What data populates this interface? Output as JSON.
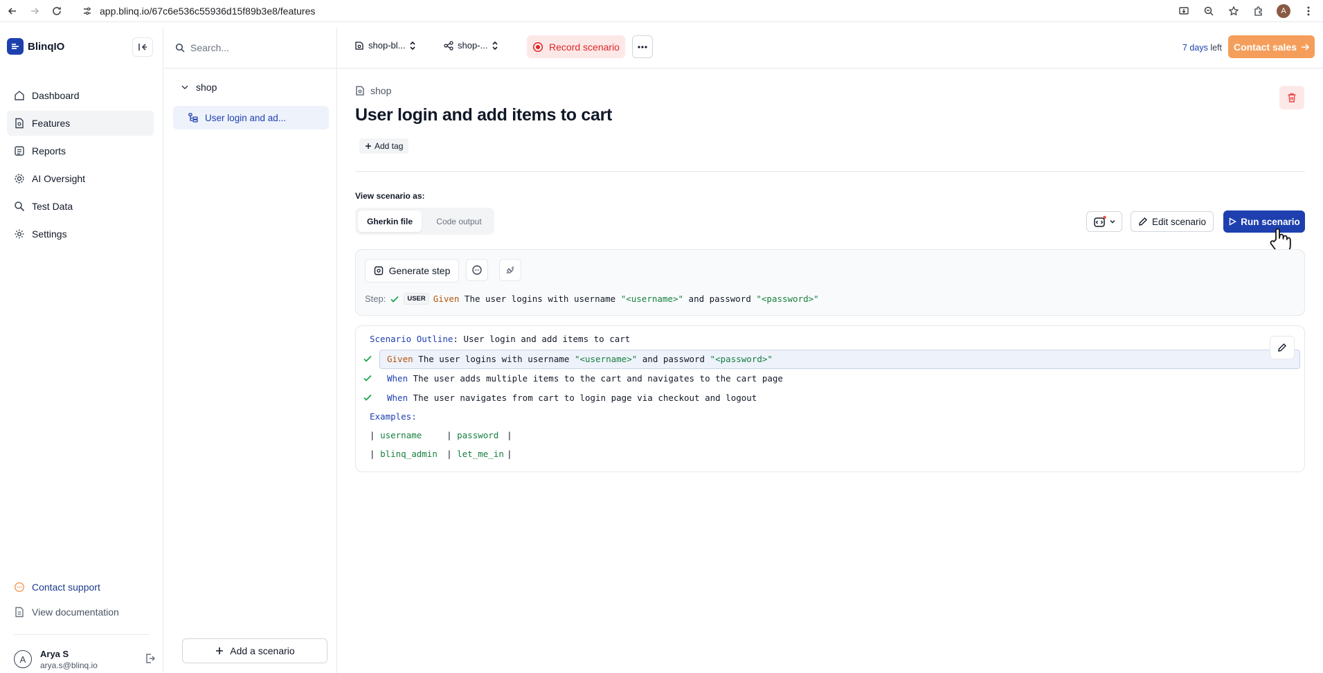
{
  "browser": {
    "url": "app.blinq.io/67c6e536c55936d15f89b3e8/features",
    "profile_initial": "A"
  },
  "sidebar": {
    "brand": "BlinqIO",
    "items": [
      {
        "label": "Dashboard",
        "icon": "home-icon"
      },
      {
        "label": "Features",
        "icon": "document-icon"
      },
      {
        "label": "Reports",
        "icon": "list-icon"
      },
      {
        "label": "AI Oversight",
        "icon": "gear-icon"
      },
      {
        "label": "Test Data",
        "icon": "search-data-icon"
      },
      {
        "label": "Settings",
        "icon": "settings-icon"
      }
    ],
    "active_item": "Features",
    "contact_support": "Contact support",
    "view_documentation": "View documentation",
    "user": {
      "initial": "A",
      "name": "Arya S",
      "email": "arya.s@blinq.io"
    }
  },
  "features_panel": {
    "search_placeholder": "Search...",
    "folder": "shop",
    "item": "User login and ad...",
    "add_scenario": "Add a scenario"
  },
  "topbar": {
    "project_select": "shop-bl...",
    "env_select": "shop-...",
    "record": "Record scenario",
    "more": "···",
    "trial_days": "7 days",
    "trial_suffix": "left",
    "contact_sales": "Contact sales"
  },
  "scenario": {
    "breadcrumb": "shop",
    "title": "User login and add items to cart",
    "add_tag": "Add tag",
    "view_as_label": "View scenario as:",
    "tabs": [
      "Gherkin file",
      "Code output"
    ],
    "active_tab": "Gherkin file",
    "edit": "Edit scenario",
    "run": "Run scenario",
    "generate_step": "Generate step",
    "step": {
      "label": "Step:",
      "badge": "USER",
      "keyword": "Given",
      "text_a": " The user logins with username ",
      "str1": "\"<username>\"",
      "text_b": " and password ",
      "str2": "\"<password>\""
    },
    "code": {
      "outline_kw": "Scenario Outline",
      "outline_rest": ": User login and add items to cart",
      "lines": [
        {
          "kw": "Given",
          "a": " The user logins with username ",
          "s1": "\"<username>\"",
          "b": " and password ",
          "s2": "\"<password>\""
        },
        {
          "kw": "When",
          "a": " The user adds multiple items to the cart and navigates to the cart page"
        },
        {
          "kw": "When",
          "a": " The user navigates from cart to login page via checkout and logout"
        }
      ],
      "examples_kw": "Examples:",
      "table": [
        [
          "username",
          "password"
        ],
        [
          "blinq_admin",
          "let_me_in"
        ]
      ]
    }
  },
  "colors": {
    "accent": "#1e40af",
    "record": "#dc2626",
    "contact": "#f59e5b",
    "check": "#16a34a"
  }
}
